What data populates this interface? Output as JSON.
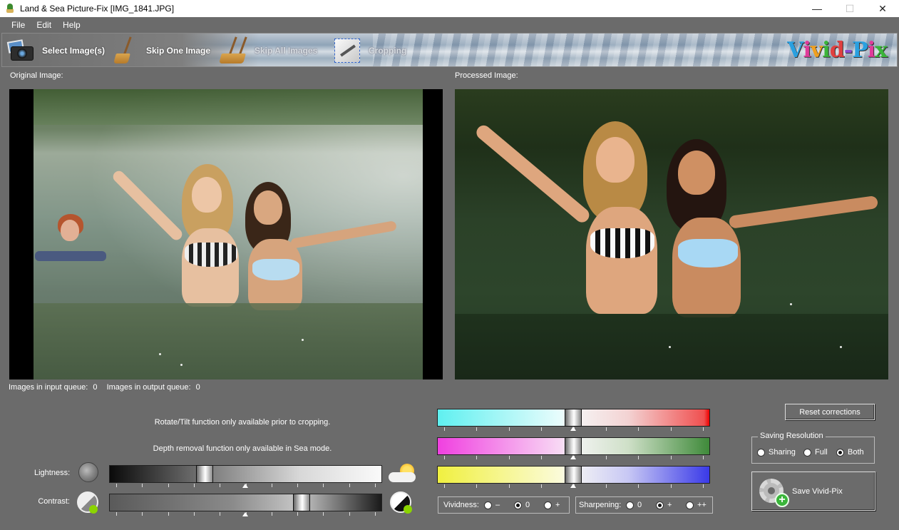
{
  "window": {
    "title": "Land & Sea Picture-Fix  [IMG_1841.JPG]",
    "minimize": "—",
    "maximize": "☐",
    "close": "✕"
  },
  "menu": [
    "File",
    "Edit",
    "Help"
  ],
  "toolbar": {
    "select_images": "Select Image(s)",
    "skip_one": "Skip One Image",
    "skip_all": "Skip All Images",
    "cropping": "Cropping",
    "logo": "Vivid-Pix",
    "logo_colors": [
      "#2aa0e0",
      "#e03a9a",
      "#f0a020",
      "#3ab53a",
      "#e04040",
      "#8a4ad0",
      "#2aa0e0",
      "#e03a9a",
      "#3ab53a"
    ]
  },
  "panels": {
    "original_label": "Original Image:",
    "processed_label": "Processed Image:"
  },
  "queue": {
    "input_label": "Images in input queue:",
    "input_count": "0",
    "output_label": "Images in output queue:",
    "output_count": "0"
  },
  "notes": {
    "rotate": "Rotate/Tilt function only available prior to cropping.",
    "depth": "Depth removal function only available in Sea mode."
  },
  "sliders": {
    "lightness_label": "Lightness:",
    "contrast_label": "Contrast:",
    "lightness_value": 0.34,
    "contrast_value": 0.72,
    "color_values": {
      "cyan_red": 0.5,
      "magenta_green": 0.5,
      "yellow_blue": 0.5
    }
  },
  "vividness": {
    "label": "Vividness:",
    "options": [
      "–",
      "0",
      "+"
    ],
    "selected": "0"
  },
  "sharpening": {
    "label": "Sharpening:",
    "options": [
      "0",
      "+",
      "++"
    ],
    "selected": "+"
  },
  "buttons": {
    "reset": "Reset corrections",
    "save": "Save Vivid-Pix"
  },
  "saving_resolution": {
    "title": "Saving Resolution",
    "options": [
      "Sharing",
      "Full",
      "Both"
    ],
    "selected": "Both"
  }
}
